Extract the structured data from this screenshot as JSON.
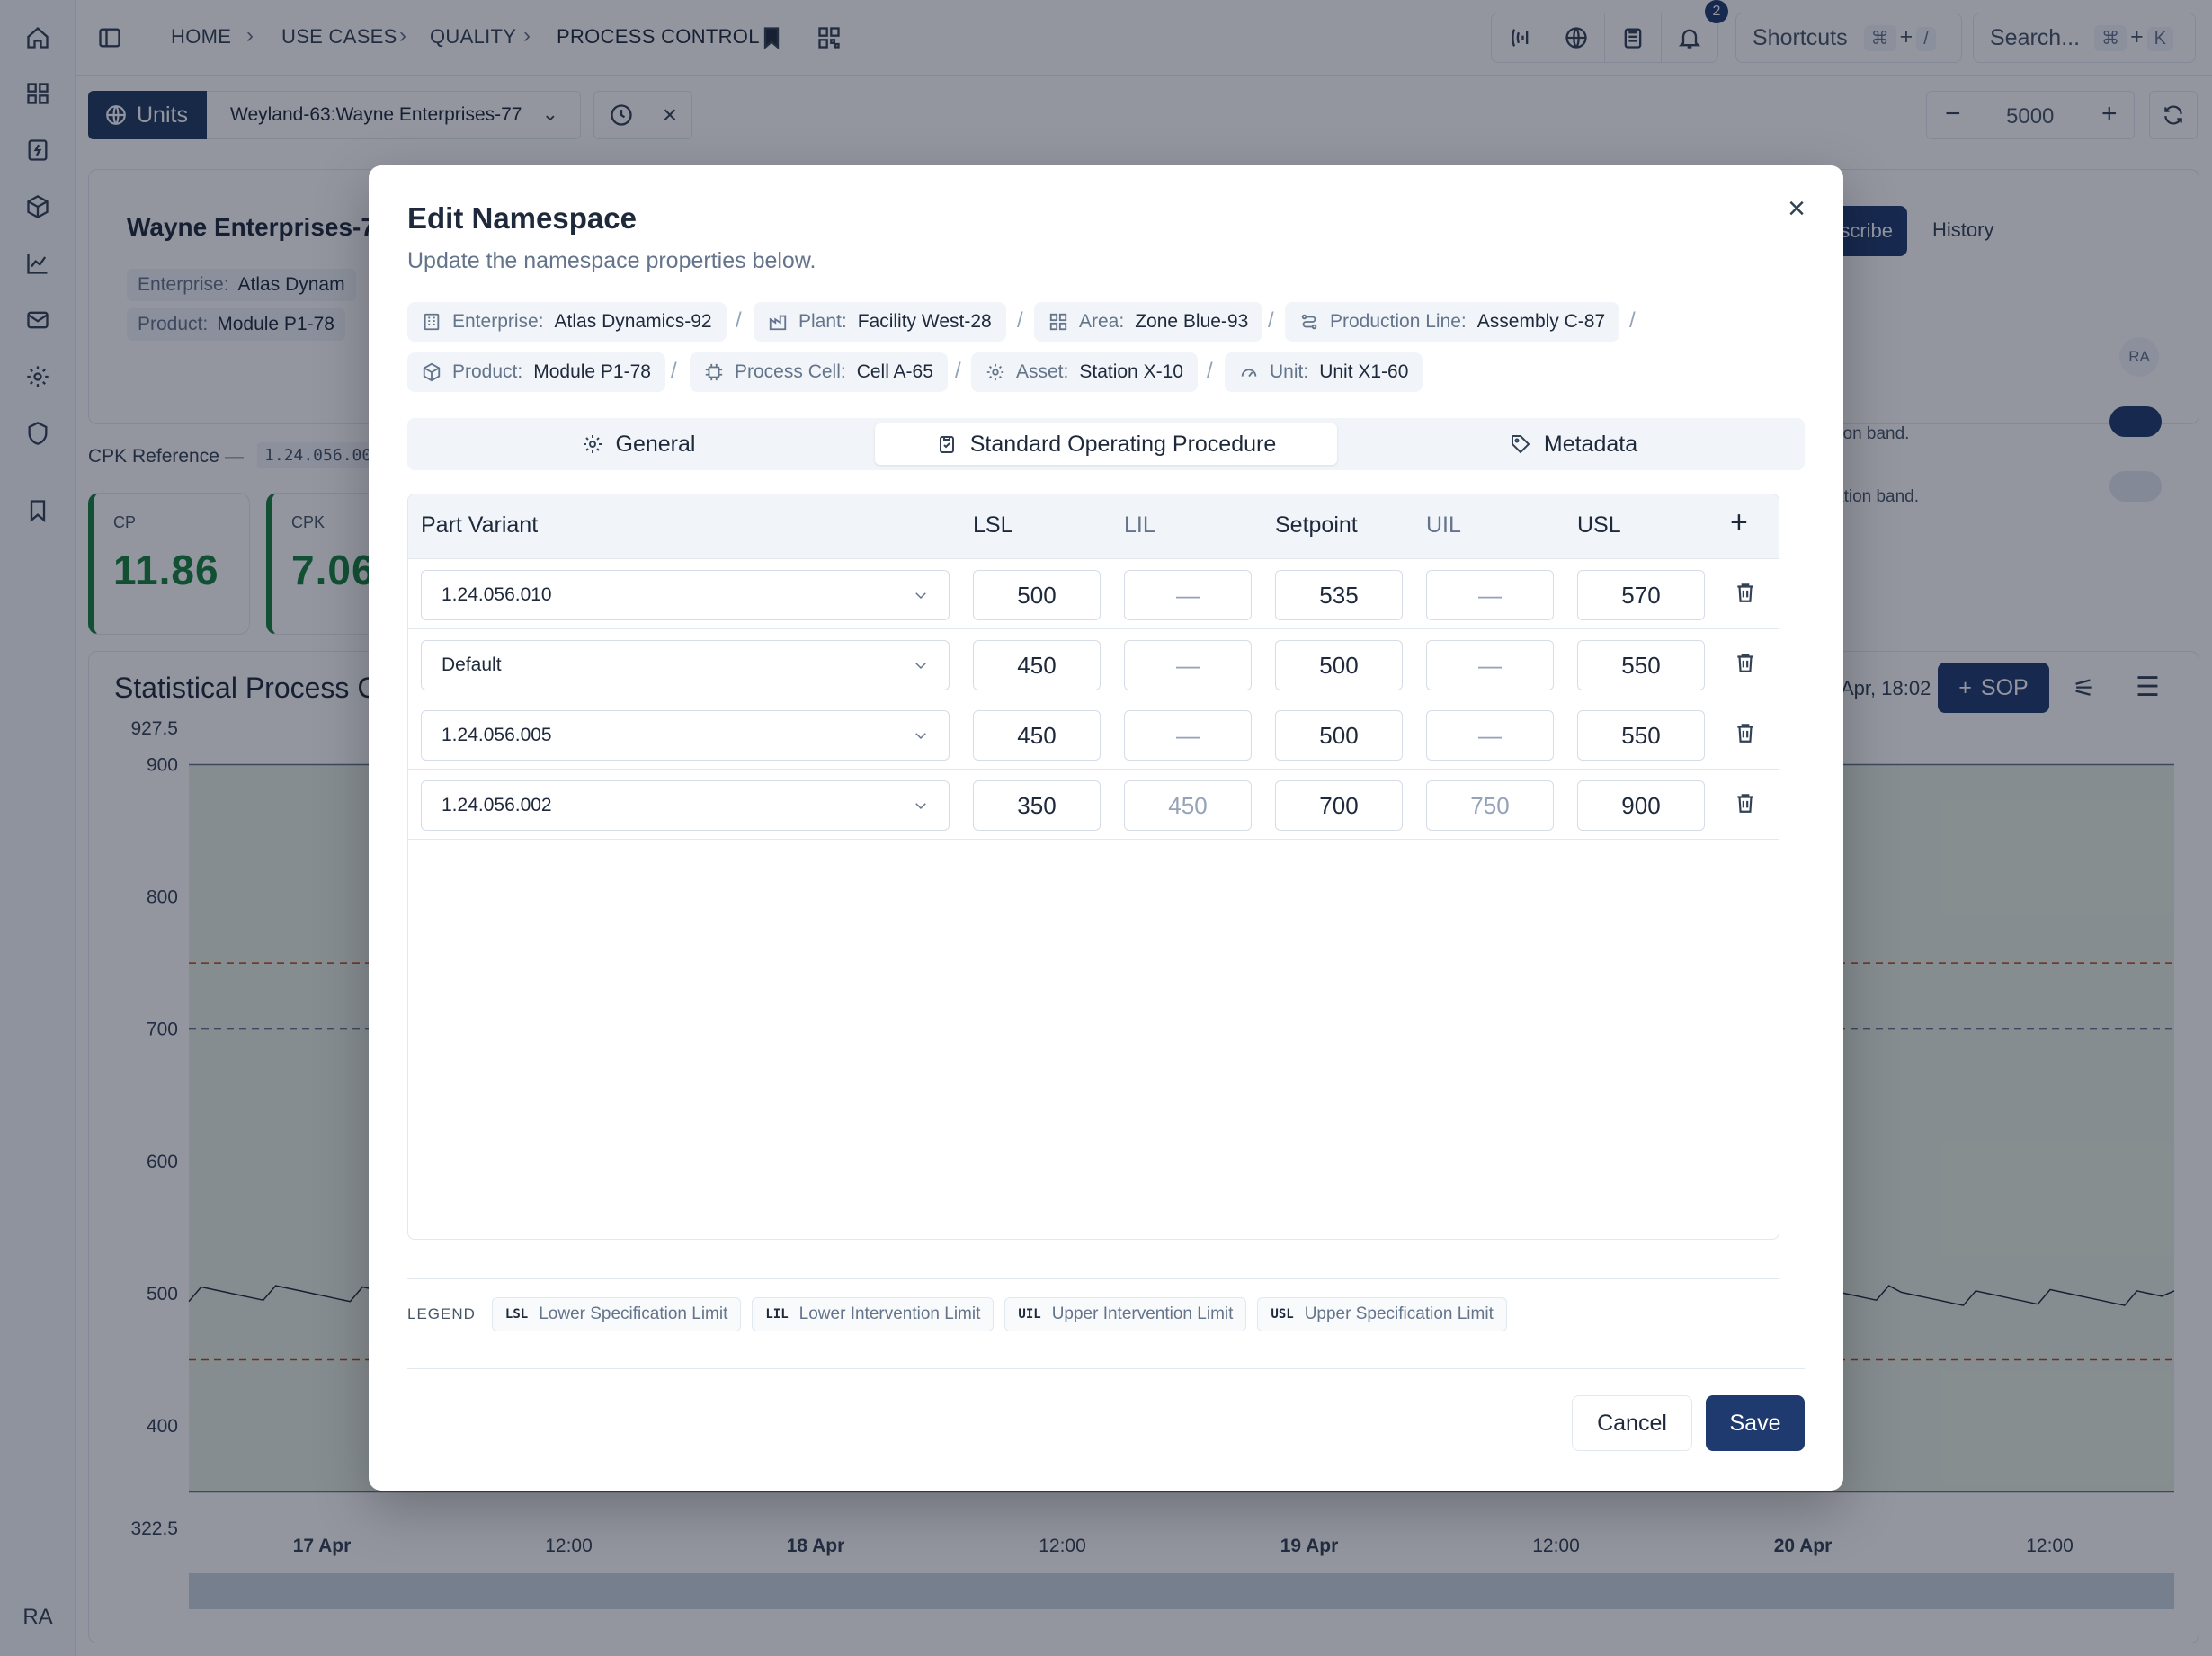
{
  "breadcrumb": {
    "home": "HOME",
    "use_cases": "USE CASES",
    "quality": "QUALITY",
    "current": "PROCESS CONTROL"
  },
  "header": {
    "notification_count": "2",
    "shortcuts_label": "Shortcuts",
    "shortcuts_key1": "⌘",
    "shortcuts_plus": "+",
    "shortcuts_key2": "/",
    "search_placeholder": "Search...",
    "search_key1": "⌘",
    "search_plus": "+",
    "search_key2": "K"
  },
  "toolbar": {
    "units_label": "Units",
    "units_selected": "Weyland-63:Wayne Enterprises-77",
    "count_value": "5000"
  },
  "background": {
    "card_title": "Wayne Enterprises-77",
    "enterprise_label": "Enterprise:",
    "enterprise_value": "Atlas Dynam",
    "product_label": "Product:",
    "product_value": "Module P1-78",
    "subscribe_label": "scribe",
    "history_label": "History",
    "avatar_small": "RA",
    "band_text_1": "tion band.",
    "band_text_2": "ation band.",
    "cpk_reference_label": "CPK Reference",
    "cpk_reference_dash": "—",
    "cpk_reference_value": "1.24.056.00",
    "kpis": [
      {
        "label": "CP",
        "value": "11.86"
      },
      {
        "label": "CPK",
        "value": "7.06"
      }
    ],
    "chart_title": "Statistical Process C",
    "chart_date": "Apr, 18:02",
    "sop_button": "SOP",
    "rail_avatar": "RA"
  },
  "chart_data": {
    "type": "line",
    "title": "Statistical Process C",
    "ylim": [
      322.5,
      927.5
    ],
    "y_ticks": [
      "927.5",
      "900",
      "800",
      "700",
      "600",
      "500",
      "400",
      "322.5"
    ],
    "x_ticks": [
      "17 Apr",
      "12:00",
      "18 Apr",
      "12:00",
      "19 Apr",
      "12:00",
      "20 Apr",
      "12:00"
    ],
    "reference_lines": [
      900,
      750,
      700,
      450,
      350
    ],
    "series": [
      {
        "values": [
          500,
          495,
          505,
          498,
          502,
          500,
          497,
          503
        ]
      }
    ]
  },
  "modal": {
    "title": "Edit Namespace",
    "subtitle": "Update the namespace properties below.",
    "hierarchy": [
      {
        "label": "Enterprise:",
        "value": "Atlas Dynamics-92",
        "icon": "building-icon"
      },
      {
        "label": "Plant:",
        "value": "Facility West-28",
        "icon": "factory-icon"
      },
      {
        "label": "Area:",
        "value": "Zone Blue-93",
        "icon": "grid-icon"
      },
      {
        "label": "Production Line:",
        "value": "Assembly C-87",
        "icon": "route-icon"
      },
      {
        "label": "Product:",
        "value": "Module P1-78",
        "icon": "box-icon"
      },
      {
        "label": "Process Cell:",
        "value": "Cell A-65",
        "icon": "chip-icon"
      },
      {
        "label": "Asset:",
        "value": "Station X-10",
        "icon": "cog-icon"
      },
      {
        "label": "Unit:",
        "value": "Unit X1-60",
        "icon": "gauge-icon"
      }
    ],
    "separator": "/",
    "tabs": {
      "general": "General",
      "sop": "Standard Operating Procedure",
      "metadata": "Metadata"
    },
    "table": {
      "headers": {
        "variant": "Part Variant",
        "lsl": "LSL",
        "lil": "LIL",
        "setpoint": "Setpoint",
        "uil": "UIL",
        "usl": "USL",
        "add": "+"
      },
      "rows": [
        {
          "variant": "1.24.056.010",
          "lsl": "500",
          "lil": "—",
          "setpoint": "535",
          "uil": "—",
          "usl": "570"
        },
        {
          "variant": "Default",
          "lsl": "450",
          "lil": "—",
          "setpoint": "500",
          "uil": "—",
          "usl": "550"
        },
        {
          "variant": "1.24.056.005",
          "lsl": "450",
          "lil": "—",
          "setpoint": "500",
          "uil": "—",
          "usl": "550"
        },
        {
          "variant": "1.24.056.002",
          "lsl": "350",
          "lil": "450",
          "setpoint": "700",
          "uil": "750",
          "usl": "900"
        }
      ]
    },
    "legend": {
      "title": "LEGEND",
      "items": [
        {
          "code": "LSL",
          "text": "Lower Specification Limit"
        },
        {
          "code": "LIL",
          "text": "Lower Intervention Limit"
        },
        {
          "code": "UIL",
          "text": "Upper Intervention Limit"
        },
        {
          "code": "USL",
          "text": "Upper Specification Limit"
        }
      ]
    },
    "cancel": "Cancel",
    "save": "Save",
    "close": "×"
  }
}
